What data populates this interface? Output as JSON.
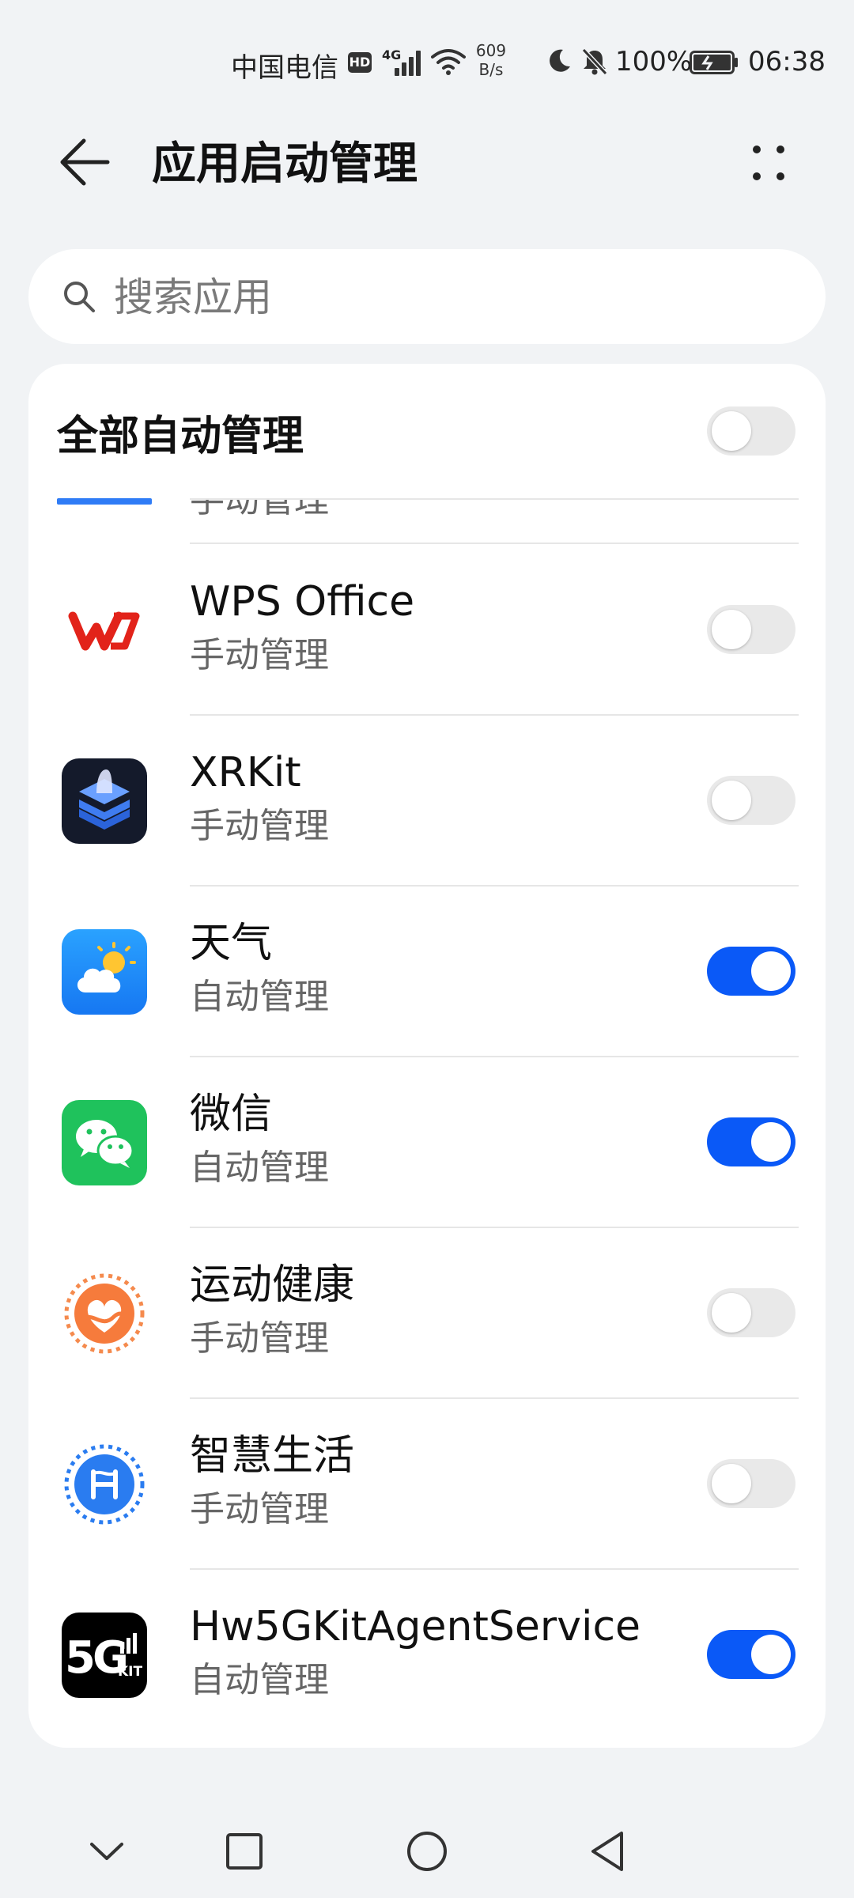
{
  "status_bar": {
    "carrier": "中国电信",
    "hd_badge": "HD",
    "network": "4G",
    "speed_value": "609",
    "speed_unit": "B/s",
    "battery_percent": "100%",
    "time": "06:38"
  },
  "header": {
    "title": "应用启动管理"
  },
  "search": {
    "placeholder": "搜索应用",
    "value": ""
  },
  "all_auto": {
    "label": "全部自动管理",
    "enabled": false
  },
  "partial_item": {
    "status": "手动管理"
  },
  "apps": [
    {
      "name": "WPS Office",
      "status": "手动管理",
      "icon": "wps-office-icon",
      "enabled": false
    },
    {
      "name": "XRKit",
      "status": "手动管理",
      "icon": "xrkit-icon",
      "enabled": false
    },
    {
      "name": "天气",
      "status": "自动管理",
      "icon": "weather-icon",
      "enabled": true
    },
    {
      "name": "微信",
      "status": "自动管理",
      "icon": "wechat-icon",
      "enabled": true
    },
    {
      "name": "运动健康",
      "status": "手动管理",
      "icon": "health-icon",
      "enabled": false
    },
    {
      "name": "智慧生活",
      "status": "手动管理",
      "icon": "smart-life-icon",
      "enabled": false
    },
    {
      "name": "Hw5GKitAgentService",
      "status": "自动管理",
      "icon": "5g-kit-icon",
      "enabled": true
    }
  ],
  "colors": {
    "accent": "#0a59f7",
    "background": "#f1f3f5",
    "toggle_off": "#e9e9e9"
  }
}
